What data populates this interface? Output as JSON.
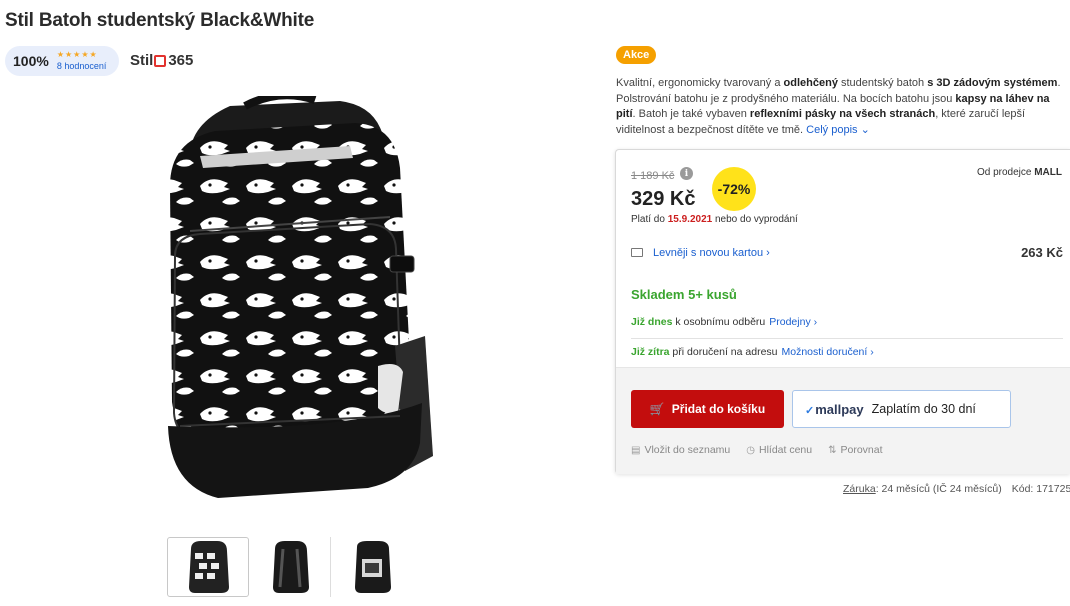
{
  "product": {
    "title": "Stil Batoh studentský Black&White",
    "badge": "Akce"
  },
  "rating": {
    "percent": "100%",
    "stars": "★★★★★",
    "stars_value": 5,
    "count": "8 hodnocení"
  },
  "brand": {
    "part1": "Stil",
    "part2": "365"
  },
  "description": {
    "t1": "Kvalitní, ergonomicky tvarovaný a ",
    "b1": "odlehčený",
    "t2": " studentský batoh ",
    "b2": "s 3D zádovým systémem",
    "t3": ". Polstrování batohu je z prodyšného materiálu. Na bocích batohu jsou ",
    "b3": "kapsy na láhev na pití",
    "t4": ". Batoh je také vybaven ",
    "b4": "reflexními pásky na všech stranách",
    "t5": ", které zaručí lepší viditelnost a bezpečnost dítěte ve tmě.",
    "more": "Celý popis"
  },
  "pricing": {
    "old_price": "1 189 Kč",
    "info_icon": "i",
    "price": "329 Kč",
    "discount": "-72%",
    "valid_prefix": "Platí do ",
    "valid_date": "15.9.2021",
    "valid_suffix": " nebo do vyprodání",
    "seller_prefix": "Od prodejce ",
    "seller": "MALL"
  },
  "card_offer": {
    "label": "Levněji s novou kartou",
    "price": "263 Kč"
  },
  "availability": {
    "stock": "Skladem 5+ kusů",
    "pickup_green": "Již dnes",
    "pickup_text": " k osobnímu odběru",
    "pickup_link": "Prodejny",
    "delivery_green": "Již zítra",
    "delivery_text": " při doručení na adresu",
    "delivery_link": "Možnosti doručení"
  },
  "buttons": {
    "cart": "Přidat do košíku",
    "mallpay_logo": "mallpay",
    "mallpay": "Zaplatím do 30 dní"
  },
  "actions": {
    "wishlist": "Vložit do seznamu",
    "watch": "Hlídat cenu",
    "compare": "Porovnat"
  },
  "footer": {
    "warranty_label": "Záruka",
    "warranty_value": ": 24 měsíců (IČ 24 měsíců)",
    "code": "Kód: 171725"
  },
  "colors": {
    "accent_red": "#c30d0d",
    "stock_green": "#3aa52f",
    "link_blue": "#1a5fcf",
    "discount_yellow": "#ffe21a",
    "badge_orange": "#f5a000"
  },
  "icons": [
    "info-icon",
    "card-icon",
    "cart-icon",
    "list-icon",
    "clock-icon",
    "compare-icon",
    "chevron-right-icon",
    "chevron-down-icon"
  ]
}
